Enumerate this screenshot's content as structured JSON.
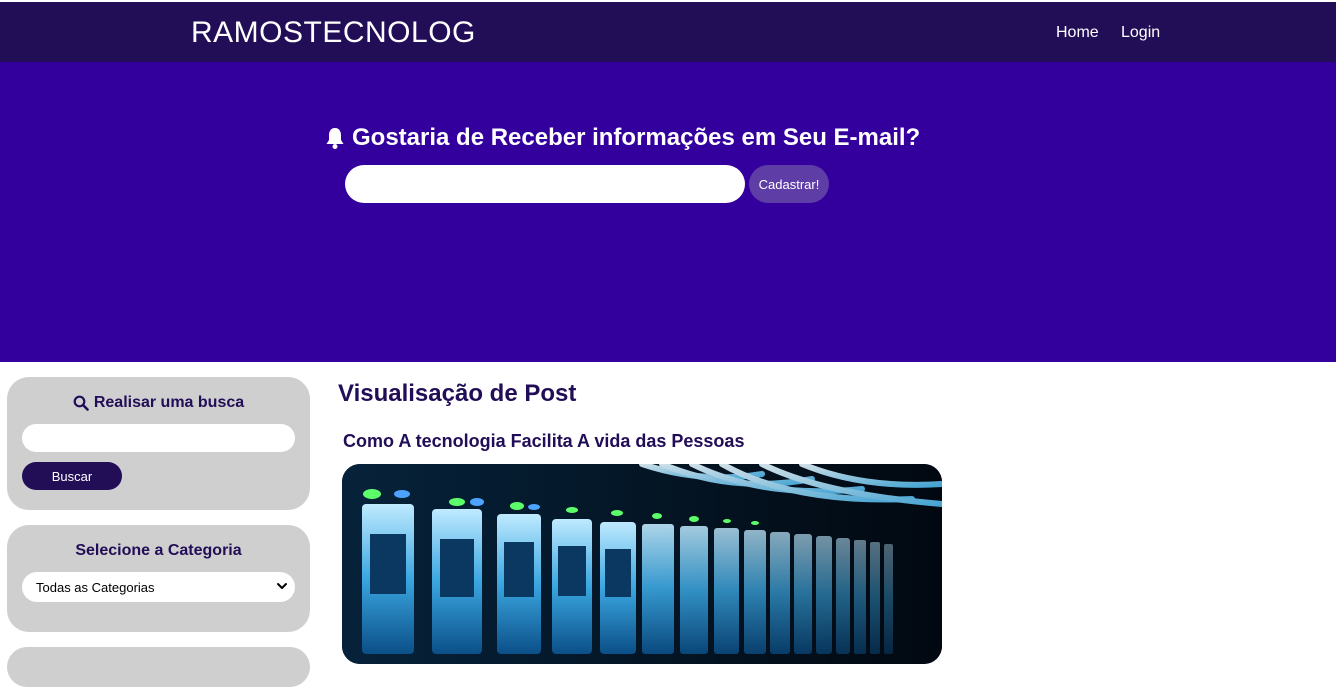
{
  "header": {
    "brand": "RAMOSTECNOLOG",
    "nav": [
      {
        "label": "Home"
      },
      {
        "label": "Login"
      }
    ]
  },
  "hero": {
    "title": "Gostaria de Receber informações em Seu E-mail?",
    "email_value": "",
    "subscribe_label": "Cadastrar!",
    "icon": "bell-icon"
  },
  "sidebar": {
    "search": {
      "title": "Realisar uma busca",
      "icon": "search-icon",
      "input_value": "",
      "button_label": "Buscar"
    },
    "category": {
      "title": "Selecione a Categoria",
      "selected": "Todas as Categorias"
    }
  },
  "main": {
    "page_title": "Visualisação de Post",
    "post": {
      "title": "Como A tecnologia Facilita A vida das Pessoas"
    }
  },
  "colors": {
    "navbar": "#220d57",
    "hero": "#33009e",
    "button_secondary": "#5e3da6",
    "card": "#cfcfcf"
  }
}
